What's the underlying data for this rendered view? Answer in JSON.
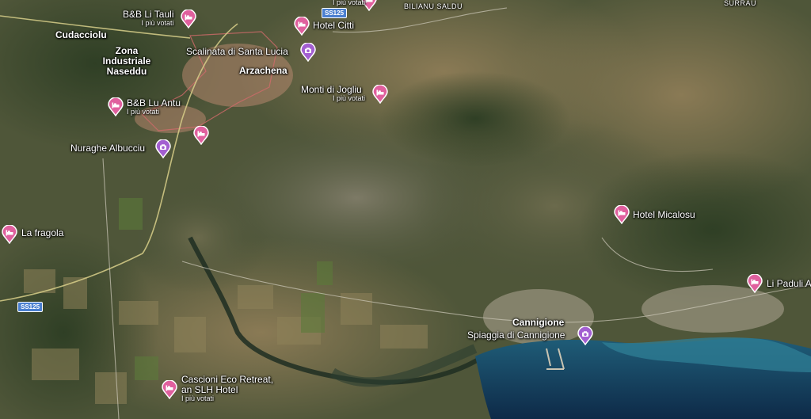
{
  "colors": {
    "pin_hotel": "#e0609e",
    "pin_attraction": "#a35fd1",
    "sea_deep": "#0e2a48",
    "sea_shallow": "#2f7f95"
  },
  "places": {
    "cudacciolu": "Cudacciolu",
    "zona_industriale": "Zona Industriale Naseddu",
    "arzachena": "Arzachena",
    "cannigione": "Cannigione",
    "bilianu_saldu": "BILIANU SALDU",
    "surrau": "SURRAU"
  },
  "roads": {
    "ss125_top": "SS125",
    "ss125_left": "SS125"
  },
  "pois": [
    {
      "id": "bb-li-tauli",
      "name": "B&B Li Tauli",
      "sub": "I più votati",
      "kind": "hotel",
      "icon": "bed-icon"
    },
    {
      "id": "hotel-citti",
      "name": "Hotel Citti",
      "sub": "",
      "kind": "hotel",
      "icon": "bed-icon"
    },
    {
      "id": "top-pin",
      "name": "",
      "sub": "I più votati",
      "kind": "hotel",
      "icon": "bed-icon"
    },
    {
      "id": "scalinata",
      "name": "Scalinata di Santa Lucia",
      "sub": "",
      "kind": "attraction",
      "icon": "camera-icon"
    },
    {
      "id": "monti-di-jogliu",
      "name": "Monti di Jogliu",
      "sub": "I più votati",
      "kind": "hotel",
      "icon": "bed-icon"
    },
    {
      "id": "bb-lu-antu",
      "name": "B&B Lu Antu",
      "sub": "I più votati",
      "kind": "hotel",
      "icon": "bed-icon"
    },
    {
      "id": "unnamed-hotel",
      "name": "",
      "sub": "",
      "kind": "hotel",
      "icon": "bed-icon"
    },
    {
      "id": "nuraghe-albucciu",
      "name": "Nuraghe Albucciu",
      "sub": "",
      "kind": "attraction",
      "icon": "camera-icon"
    },
    {
      "id": "la-fragola",
      "name": "La fragola",
      "sub": "",
      "kind": "hotel",
      "icon": "bed-icon"
    },
    {
      "id": "hotel-micalosu",
      "name": "Hotel Micalosu",
      "sub": "",
      "kind": "hotel",
      "icon": "bed-icon"
    },
    {
      "id": "li-paduli",
      "name": "Li Paduli A",
      "sub": "",
      "kind": "hotel",
      "icon": "bed-icon"
    },
    {
      "id": "spiaggia-cannigione",
      "name": "Spiaggia di Cannigione",
      "sub": "",
      "kind": "attraction",
      "icon": "camera-icon"
    },
    {
      "id": "cascioni",
      "name": "Cascioni Eco Retreat, an SLH Hotel",
      "sub": "I più votati",
      "kind": "hotel",
      "icon": "bed-icon"
    }
  ]
}
